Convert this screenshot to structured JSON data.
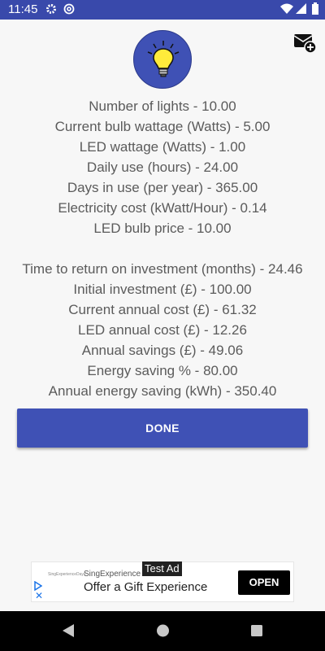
{
  "status_bar": {
    "time": "11:45",
    "icons": [
      "gear-icon",
      "at-sign-icon",
      "wifi-icon",
      "signal-icon",
      "battery-icon"
    ]
  },
  "header": {
    "logo_icon": "lightbulb-icon",
    "share_icon": "mail-add-icon"
  },
  "inputs": [
    "Number of lights - 10.00",
    "Current bulb wattage (Watts) - 5.00",
    "LED wattage (Watts) - 1.00",
    "Daily use (hours) - 24.00",
    "Days in use (per year) - 365.00",
    "Electricity cost (kWatt/Hour) - 0.14",
    "LED bulb price - 10.00"
  ],
  "results": [
    "Time to return on investment (months) - 24.46",
    "Initial investment (£) - 100.00",
    "Current annual cost (£) - 61.32",
    "LED annual cost (£) - 12.26",
    "Annual savings (£) - 49.06",
    "Energy saving % - 80.00",
    "Annual energy saving (kWh) - 350.40"
  ],
  "done_button": "DONE",
  "ad": {
    "tag": "Test Ad",
    "advertiser_logo": "SingExperienceDays",
    "advertiser": "SingExperience",
    "headline": "Offer a Gift Experience",
    "cta": "OPEN"
  },
  "colors": {
    "primary": "#3f51b5",
    "status_bar": "#3949ab",
    "bulb_yellow": "#ffeb3b",
    "text": "#5b5b5b"
  }
}
